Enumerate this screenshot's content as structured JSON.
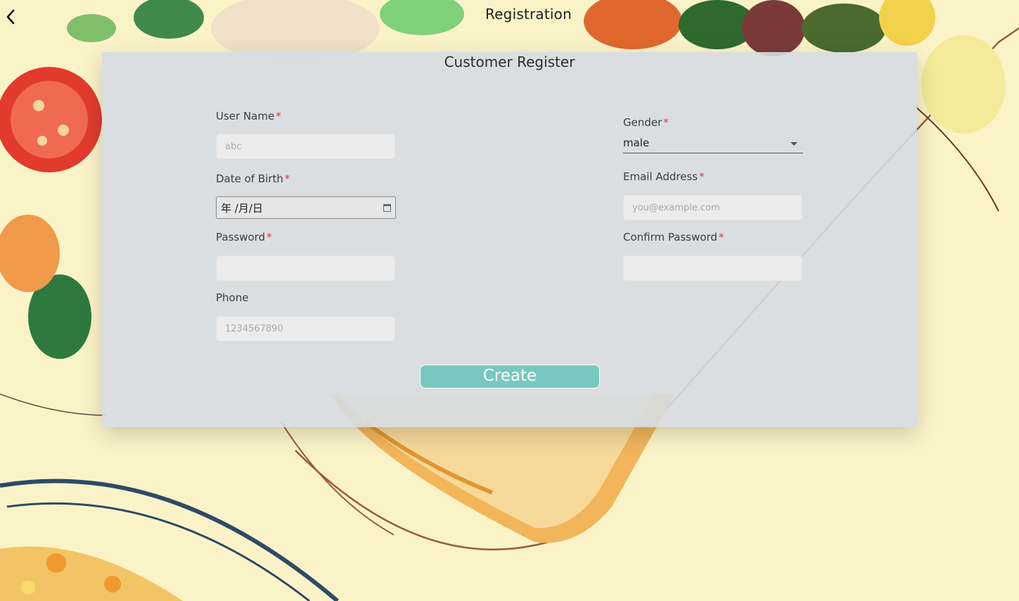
{
  "header": {
    "title": "Registration",
    "back_icon": "chevron-left-icon"
  },
  "form": {
    "title": "Customer Register",
    "required_marker": "*",
    "username": {
      "label": "User Name",
      "placeholder": "abc"
    },
    "dob": {
      "label": "Date of Birth",
      "value": "年 /月/日",
      "icon": "calendar-icon"
    },
    "password": {
      "label": "Password",
      "placeholder": ""
    },
    "phone": {
      "label": "Phone",
      "placeholder": "1234567890"
    },
    "gender": {
      "label": "Gender",
      "value": "male",
      "icon": "caret-down-icon"
    },
    "email": {
      "label": "Email Address",
      "placeholder": "you@example.com"
    },
    "confirm_password": {
      "label": "Confirm Password",
      "placeholder": ""
    },
    "create_label": "Create"
  },
  "colors": {
    "background": "#fbf3c8",
    "card": "#d6dbe2",
    "accent": "#78c8bf",
    "required": "#e0383e"
  }
}
